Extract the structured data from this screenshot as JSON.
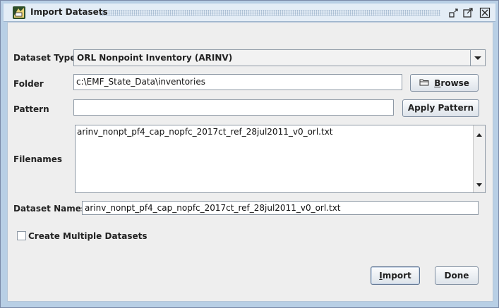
{
  "window": {
    "title": "Import Datasets"
  },
  "form": {
    "dataset_type_label": "Dataset Type",
    "dataset_type_value": "ORL Nonpoint Inventory (ARINV)",
    "folder_label": "Folder",
    "folder_value": "c:\\EMF_State_Data\\inventories",
    "browse_label_pre": "",
    "browse_mnemonic": "B",
    "browse_label_post": "rowse",
    "pattern_label": "Pattern",
    "pattern_value": "",
    "apply_pattern_label": "Apply Pattern",
    "filenames_label": "Filenames",
    "filenames_value": "arinv_nonpt_pf4_cap_nopfc_2017ct_ref_28jul2011_v0_orl.txt",
    "dataset_names_label": "Dataset Names",
    "dataset_names_value": "arinv_nonpt_pf4_cap_nopfc_2017ct_ref_28jul2011_v0_orl.txt",
    "create_multiple_label": "Create Multiple Datasets",
    "create_multiple_checked": false
  },
  "footer": {
    "import_mnemonic": "I",
    "import_rest": "mport",
    "done_label": "Done"
  },
  "icons": {
    "app": "emf-app-icon",
    "minimize": "minimize-icon",
    "maximize": "maximize-icon",
    "close": "close-icon",
    "dropdown": "chevron-down-icon",
    "browse": "folder-icon"
  }
}
